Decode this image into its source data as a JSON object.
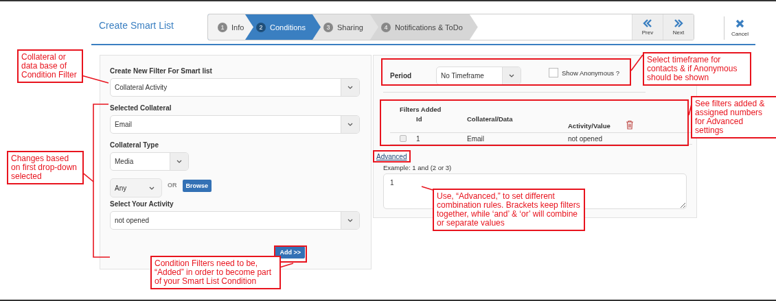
{
  "header": {
    "title": "Create Smart List"
  },
  "steps": [
    {
      "number": "1",
      "label": "Info",
      "selected": false
    },
    {
      "number": "2",
      "label": "Conditions",
      "selected": true
    },
    {
      "number": "3",
      "label": "Sharing",
      "selected": false
    },
    {
      "number": "4",
      "label": "Notifications & ToDo",
      "selected": false
    }
  ],
  "nav": [
    {
      "kind": "prev",
      "label": "Prev"
    },
    {
      "kind": "next",
      "label": "Next"
    }
  ],
  "cancel": {
    "label": "Cancel"
  },
  "filter_form": {
    "fields": [
      {
        "kind": "wide_select",
        "label": "Create New Filter For Smart list",
        "value": "Collateral Activity"
      },
      {
        "kind": "wide_select",
        "label": "Selected Collateral",
        "value": "Email"
      },
      {
        "kind": "short_select",
        "label": "Collateral Type",
        "value": "Media"
      },
      {
        "kind": "any_browse",
        "value": "Any",
        "or": "OR",
        "button": "Browse"
      },
      {
        "kind": "wide_select",
        "label": "Select Your Activity",
        "value": "not opened"
      }
    ],
    "add_button": "Add >>"
  },
  "period": {
    "label": "Period",
    "value": "No Timeframe",
    "show_anonymous": {
      "label": "Show Anonymous ?",
      "checked": false
    }
  },
  "filters_added": {
    "title": "Filters Added",
    "columns": [
      "Id",
      "Collateral/Data",
      "Activity/Value"
    ],
    "rows": [
      {
        "checked": false,
        "cells": [
          "1",
          "Email",
          "not opened"
        ]
      }
    ]
  },
  "advanced": {
    "link": "Advanced",
    "hint": "Example: 1 and (2 or 3)",
    "value": "1"
  },
  "annotations": [
    {
      "text": "Collateral or data base of Condition Filter"
    },
    {
      "text": "Changes based on first drop-down selected"
    },
    {
      "text": "Condition Filters need to be, “Added” in order to become part of your Smart List Condition"
    },
    {
      "text": "Select timeframe for contacts & if Anonymous should be shown"
    },
    {
      "text": "See filters added & assigned numbers for Advanced settings"
    },
    {
      "text": "Use, “Advanced,” to set different combination rules. Brackets keep filters together, while ‘and’ & ‘or’ will combine or separate values"
    }
  ]
}
